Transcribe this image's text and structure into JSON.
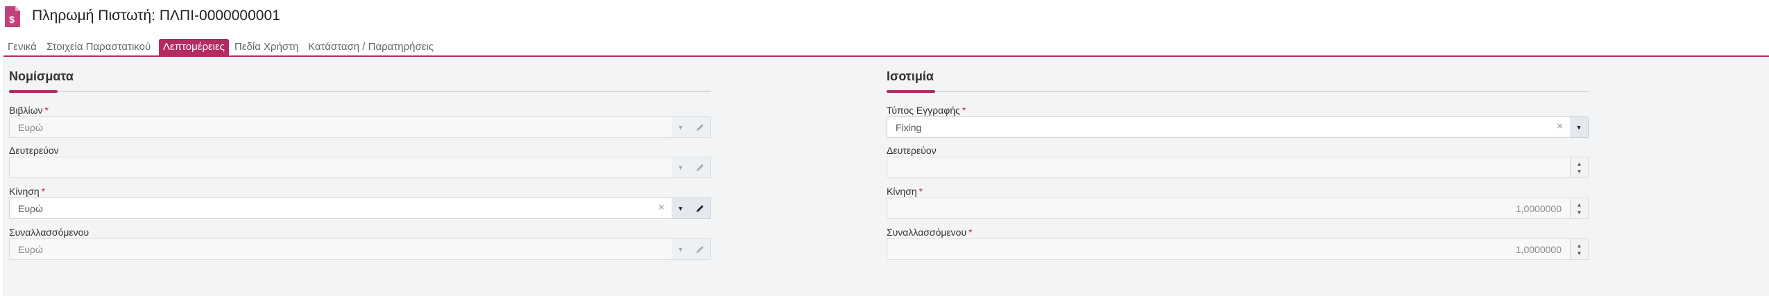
{
  "header": {
    "title": "Πληρωμή Πιστωτή: ΠΛΠΙ-0000000001",
    "icon": "document-dollar-icon",
    "accent_color": "#b42a62"
  },
  "tabs": [
    {
      "label": "Γενικά"
    },
    {
      "label": "Στοιχεία Παραστατικού"
    },
    {
      "label": "Λεπτομέρειες",
      "active": true
    },
    {
      "label": "Πεδία Χρήστη"
    },
    {
      "label": "Κατάσταση / Παρατηρήσεις"
    }
  ],
  "left": {
    "title": "Νομίσματα",
    "fields": [
      {
        "label": "Βιβλίων",
        "required": true,
        "value": "Ευρώ",
        "enabled": false
      },
      {
        "label": "Δευτερεύον",
        "required": false,
        "value": "",
        "enabled": false
      },
      {
        "label": "Κίνηση",
        "required": true,
        "value": "Ευρώ",
        "enabled": true
      },
      {
        "label": "Συναλλασσόμενου",
        "required": false,
        "value": "Ευρώ",
        "enabled": false
      }
    ]
  },
  "right": {
    "title": "Ισοτιμία",
    "fields": [
      {
        "label": "Τύπος Εγγραφής",
        "required": true,
        "value": "Fixing",
        "enabled": true
      },
      {
        "label": "Δευτερεύον",
        "required": false,
        "value": "",
        "enabled": false
      },
      {
        "label": "Κίνηση",
        "required": true,
        "value": "1,0000000",
        "enabled": false
      },
      {
        "label": "Συναλλασσόμενου",
        "required": true,
        "value": "1,0000000",
        "enabled": false
      }
    ]
  },
  "required_mark": "*",
  "glyphs": {
    "dropdown": "▼",
    "clear": "×",
    "spin_up": "▲",
    "spin_down": "▼"
  }
}
